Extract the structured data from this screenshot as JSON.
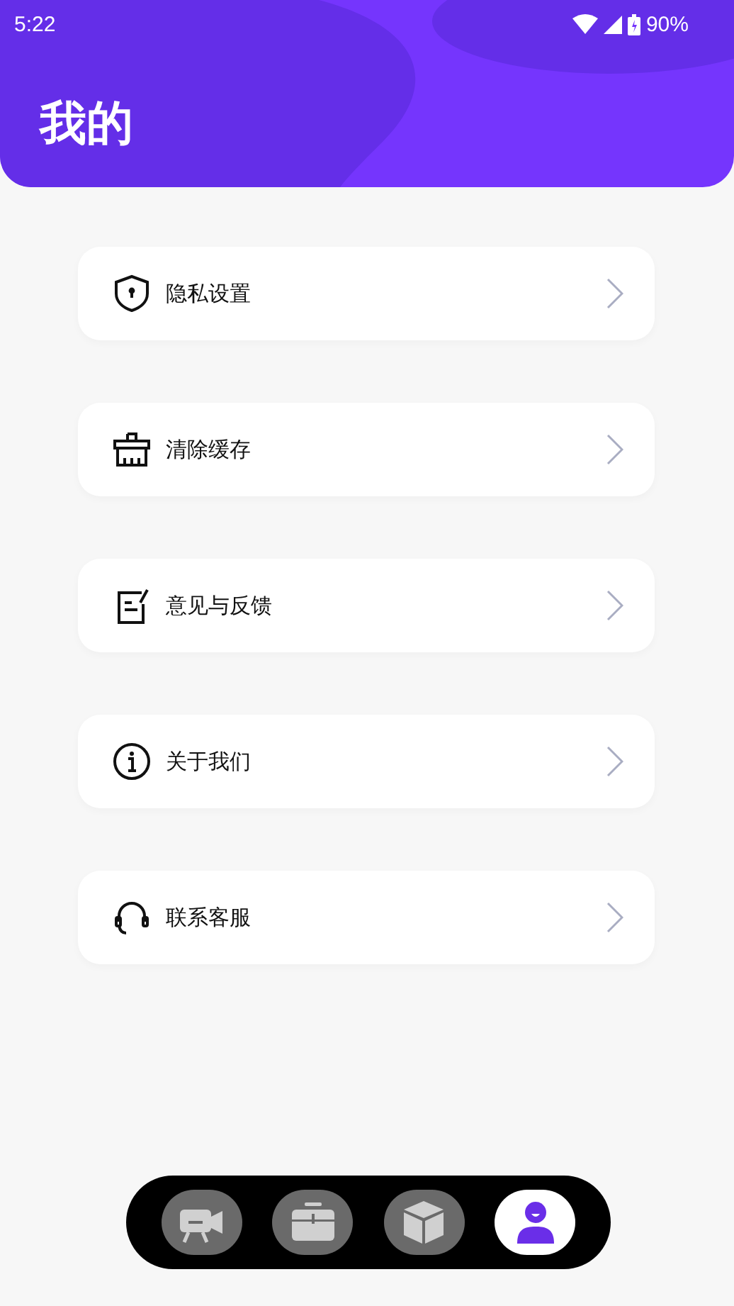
{
  "status_bar": {
    "time": "5:22",
    "battery": "90%"
  },
  "header": {
    "title": "我的"
  },
  "menu": [
    {
      "label": "隐私设置"
    },
    {
      "label": "清除缓存"
    },
    {
      "label": "意见与反馈"
    },
    {
      "label": "关于我们"
    },
    {
      "label": "联系客服"
    }
  ],
  "bottom_nav": [
    {
      "selected": false
    },
    {
      "selected": false
    },
    {
      "selected": false
    },
    {
      "selected": true
    }
  ]
}
